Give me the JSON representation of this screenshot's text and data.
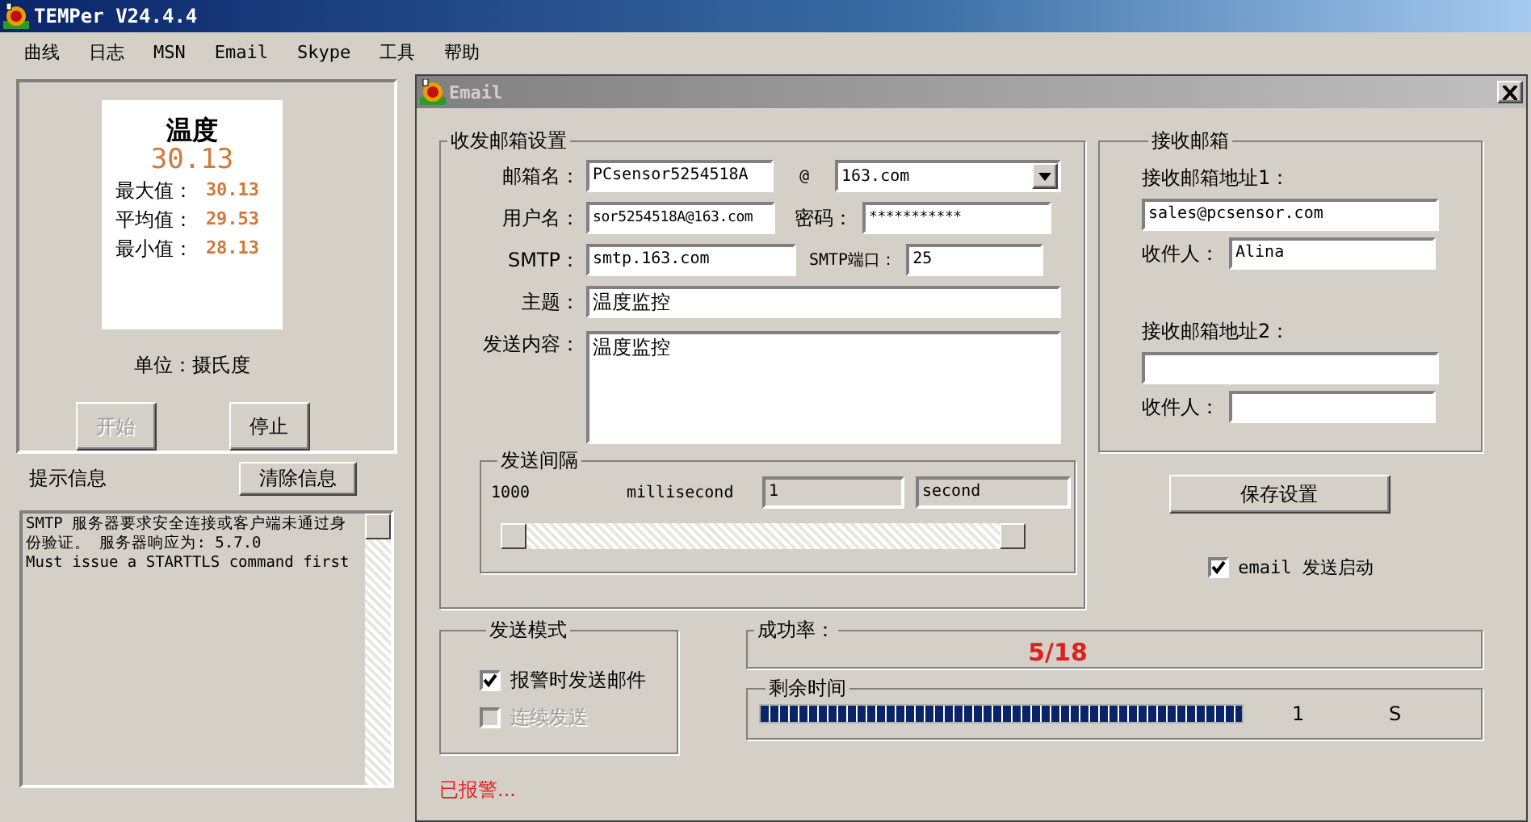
{
  "window": {
    "title": "TEMPer V24.4.4"
  },
  "menu": [
    "曲线",
    "日志",
    "MSN",
    "Email",
    "Skype",
    "工具",
    "帮助"
  ],
  "reading": {
    "title": "温度",
    "value": "30.13",
    "stats": [
      {
        "label": "最大值：",
        "value": "30.13"
      },
      {
        "label": "平均值：",
        "value": "29.53"
      },
      {
        "label": "最小值：",
        "value": "28.13"
      }
    ],
    "unit": "单位：摄氏度"
  },
  "controls": [
    {
      "label": "开始",
      "disabled": true
    },
    {
      "label": "停止",
      "disabled": false
    }
  ],
  "messages": {
    "label": "提示信息",
    "clear_button": "清除信息",
    "log": [
      "SMTP 服务器要求安全连接或客户端未通过身份验证。 服务器响应为: 5.7.0",
      "Must issue a STARTTLS command first"
    ]
  },
  "email_dialog": {
    "title": "Email",
    "sender": {
      "title": "收发邮箱设置",
      "mailbox_label": "邮箱名：",
      "mailbox": "PCsensor5254518A",
      "at": "@",
      "domain": "163.com",
      "username_label": "用户名：",
      "username": "sor5254518A@163.com",
      "password_label": "密码：",
      "password": "***********",
      "smtp_label": "SMTP：",
      "smtp": "smtp.163.com",
      "port_label": "SMTP端口：",
      "port": "25",
      "subject_label": "主题：",
      "subject": "温度监控",
      "body_label": "发送内容：",
      "body": "温度监控",
      "interval": {
        "title": "发送间隔",
        "ms": "1000",
        "ms_unit": "millisecond",
        "seconds": "1",
        "seconds_unit": "second"
      }
    },
    "recipients": {
      "title": "接收邮箱",
      "items": [
        {
          "address_label": "接收邮箱地址1：",
          "address": "sales@pcsensor.com",
          "name_label": "收件人：",
          "name": "Alina"
        },
        {
          "address_label": "接收邮箱地址2：",
          "name_label": "收件人："
        }
      ]
    },
    "save_button": "保存设置",
    "enable": {
      "label": "email 发送启动",
      "checked": true
    },
    "mode": {
      "title": "发送模式",
      "options": [
        {
          "label": "报警时发送邮件",
          "checked": true,
          "disabled": false
        },
        {
          "label": "连续发送",
          "checked": false,
          "disabled": true
        }
      ]
    },
    "success": {
      "title": "成功率：",
      "value": "5/18"
    },
    "remaining": {
      "title": "剩余时间",
      "level": 1,
      "value": "1",
      "unit": "S"
    },
    "status": "已报警..."
  }
}
